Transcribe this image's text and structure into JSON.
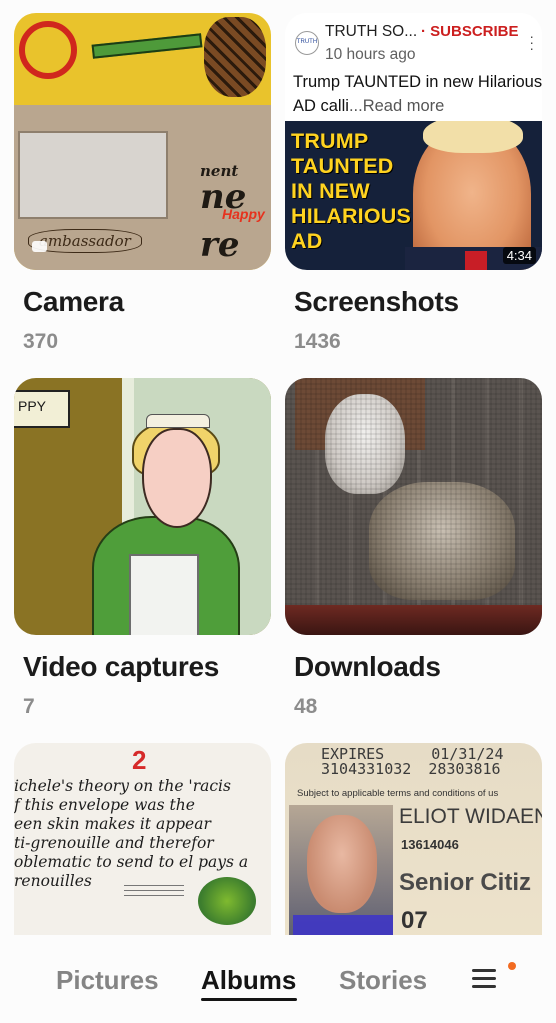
{
  "albums": [
    {
      "name": "Camera",
      "count": "370"
    },
    {
      "name": "Screenshots",
      "count": "1436"
    },
    {
      "name": "Video captures",
      "count": "7"
    },
    {
      "name": "Downloads",
      "count": "48"
    }
  ],
  "camera_thumb": {
    "text_top": "ne",
    "text_bottom": "re",
    "text_nent": "nent",
    "happy": "Happy",
    "ambassador": "ambassador"
  },
  "screenshot_thumb": {
    "channel": "TRUTH SO...",
    "subscribe": "· SUBSCRIBE",
    "time": "10 hours ago",
    "title": "Trump TAUNTED in new Hilarious AD calli",
    "read_more": "...Read more",
    "headline_lines": [
      "TRUMP",
      "TAUNTED",
      "IN NEW",
      "HILARIOUS",
      "AD"
    ],
    "duration": "4:34"
  },
  "video_thumb": {
    "sign": "PPY"
  },
  "row3_left": {
    "number": "2",
    "lines": [
      "ichele's theory on the 'racis",
      "f this envelope was the",
      "een skin makes it appear",
      "ti-grenouille and therefor",
      "oblematic to send to el pays a",
      "renouilles"
    ]
  },
  "row3_right": {
    "expires_label": "EXPIRES",
    "expires_date": "01/31/24",
    "card_number": "3104331032",
    "card_number_2": "28303816",
    "terms": "Subject to applicable terms and conditions of us",
    "name": "ELIOT  WIDAEN",
    "member_number": "13614046",
    "tier": "Senior Citiz",
    "tier_code": "07"
  },
  "bottom_nav": {
    "items": [
      "Pictures",
      "Albums",
      "Stories"
    ],
    "active": "Albums",
    "menu_icon": "hamburger-menu-icon",
    "badge_color": "#f26b21"
  }
}
